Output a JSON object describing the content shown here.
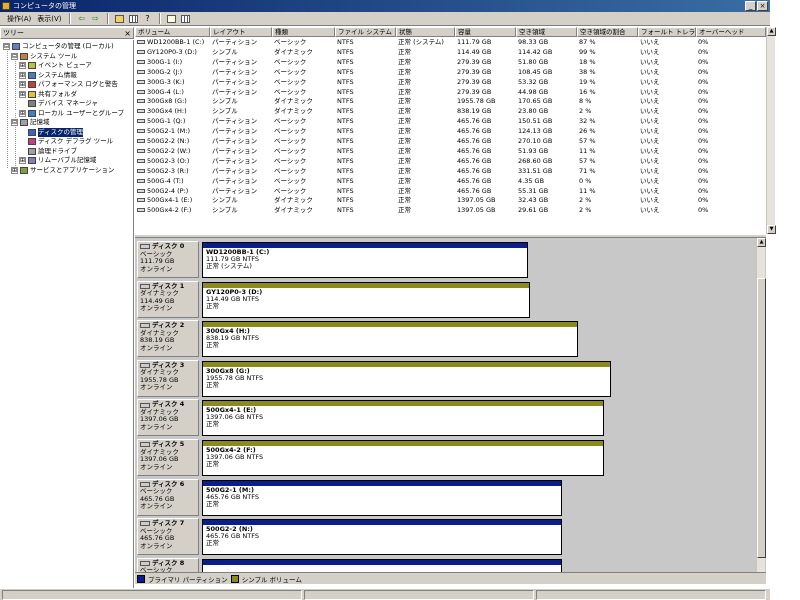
{
  "window": {
    "title": "コンピュータの管理",
    "minimize": "_",
    "close": "×"
  },
  "menu": {
    "items": [
      "操作(A)",
      "表示(V)"
    ]
  },
  "toolbar": {
    "back": "⇦",
    "forward": "⇨",
    "help": "?"
  },
  "tree": {
    "header": "ツリー",
    "close": "×",
    "nodes": [
      {
        "label": "コンピュータの管理 (ローカル)",
        "level": 0,
        "expander": "⊟",
        "icon": "computer-management-icon"
      },
      {
        "label": "システム ツール",
        "level": 1,
        "expander": "⊟",
        "icon": "tools-icon"
      },
      {
        "label": "イベント ビューア",
        "level": 2,
        "expander": "⊞",
        "icon": "event-viewer-icon"
      },
      {
        "label": "システム情報",
        "level": 2,
        "expander": "⊞",
        "icon": "system-info-icon"
      },
      {
        "label": "パフォーマンス ログと警告",
        "level": 2,
        "expander": "⊞",
        "icon": "performance-icon"
      },
      {
        "label": "共有フォルダ",
        "level": 2,
        "expander": "⊞",
        "icon": "shared-folder-icon"
      },
      {
        "label": "デバイス マネージャ",
        "level": 2,
        "expander": "",
        "icon": "device-manager-icon"
      },
      {
        "label": "ローカル ユーザーとグループ",
        "level": 2,
        "expander": "⊞",
        "icon": "users-icon"
      },
      {
        "label": "記憶域",
        "level": 1,
        "expander": "⊟",
        "icon": "storage-icon"
      },
      {
        "label": "ディスクの管理",
        "level": 2,
        "expander": "",
        "icon": "disk-management-icon",
        "selected": true
      },
      {
        "label": "ディスク デフラグ ツール",
        "level": 2,
        "expander": "",
        "icon": "defrag-icon"
      },
      {
        "label": "論理ドライブ",
        "level": 2,
        "expander": "",
        "icon": "logical-drive-icon"
      },
      {
        "label": "リムーバブル記憶域",
        "level": 2,
        "expander": "⊞",
        "icon": "removable-storage-icon"
      },
      {
        "label": "サービスとアプリケーション",
        "level": 1,
        "expander": "⊞",
        "icon": "services-icon"
      }
    ]
  },
  "volumes": {
    "columns": [
      "ボリューム",
      "レイアウト",
      "種類",
      "ファイル システム",
      "状態",
      "容量",
      "空き領域",
      "空き領域の割合",
      "フォールト トレラン...",
      "オーバーヘッド"
    ],
    "rows": [
      [
        "WD1200BB-1 (C:)",
        "パーティション",
        "ベーシック",
        "NTFS",
        "正常 (システム)",
        "111.79 GB",
        "98.33 GB",
        "87 %",
        "いいえ",
        "0%"
      ],
      [
        "GY120P0-3 (D:)",
        "シンプル",
        "ダイナミック",
        "NTFS",
        "正常",
        "114.49 GB",
        "114.42 GB",
        "99 %",
        "いいえ",
        "0%"
      ],
      [
        "300G-1 (I:)",
        "パーティション",
        "ベーシック",
        "NTFS",
        "正常",
        "279.39 GB",
        "51.80 GB",
        "18 %",
        "いいえ",
        "0%"
      ],
      [
        "300G-2 (J:)",
        "パーティション",
        "ベーシック",
        "NTFS",
        "正常",
        "279.39 GB",
        "108.45 GB",
        "38 %",
        "いいえ",
        "0%"
      ],
      [
        "300G-3 (K:)",
        "パーティション",
        "ベーシック",
        "NTFS",
        "正常",
        "279.39 GB",
        "53.32 GB",
        "19 %",
        "いいえ",
        "0%"
      ],
      [
        "300G-4 (L:)",
        "パーティション",
        "ベーシック",
        "NTFS",
        "正常",
        "279.39 GB",
        "44.98 GB",
        "16 %",
        "いいえ",
        "0%"
      ],
      [
        "300Gx8 (G:)",
        "シンプル",
        "ダイナミック",
        "NTFS",
        "正常",
        "1955.78 GB",
        "170.65 GB",
        "8 %",
        "いいえ",
        "0%"
      ],
      [
        "300Gx4 (H:)",
        "シンプル",
        "ダイナミック",
        "NTFS",
        "正常",
        "838.19 GB",
        "23.80 GB",
        "2 %",
        "いいえ",
        "0%"
      ],
      [
        "500G-1 (Q:)",
        "パーティション",
        "ベーシック",
        "NTFS",
        "正常",
        "465.76 GB",
        "150.51 GB",
        "32 %",
        "いいえ",
        "0%"
      ],
      [
        "500G2-1 (M:)",
        "パーティション",
        "ベーシック",
        "NTFS",
        "正常",
        "465.76 GB",
        "124.13 GB",
        "26 %",
        "いいえ",
        "0%"
      ],
      [
        "500G2-2 (N:)",
        "パーティション",
        "ベーシック",
        "NTFS",
        "正常",
        "465.76 GB",
        "270.10 GB",
        "57 %",
        "いいえ",
        "0%"
      ],
      [
        "500G2-2 (W:)",
        "パーティション",
        "ベーシック",
        "NTFS",
        "正常",
        "465.76 GB",
        "51.93 GB",
        "11 %",
        "いいえ",
        "0%"
      ],
      [
        "500G2-3 (O:)",
        "パーティション",
        "ベーシック",
        "NTFS",
        "正常",
        "465.76 GB",
        "268.60 GB",
        "57 %",
        "いいえ",
        "0%"
      ],
      [
        "500G2-3 (R:)",
        "パーティション",
        "ベーシック",
        "NTFS",
        "正常",
        "465.76 GB",
        "331.51 GB",
        "71 %",
        "いいえ",
        "0%"
      ],
      [
        "500G-4 (T:)",
        "パーティション",
        "ベーシック",
        "NTFS",
        "正常",
        "465.76 GB",
        "4.35 GB",
        "0 %",
        "いいえ",
        "0%"
      ],
      [
        "500G2-4 (P:)",
        "パーティション",
        "ベーシック",
        "NTFS",
        "正常",
        "465.76 GB",
        "55.31 GB",
        "11 %",
        "いいえ",
        "0%"
      ],
      [
        "500Gx4-1 (E:)",
        "シンプル",
        "ダイナミック",
        "NTFS",
        "正常",
        "1397.05 GB",
        "32.43 GB",
        "2 %",
        "いいえ",
        "0%"
      ],
      [
        "500Gx4-2 (F:)",
        "シンプル",
        "ダイナミック",
        "NTFS",
        "正常",
        "1397.05 GB",
        "29.61 GB",
        "2 %",
        "いいえ",
        "0%"
      ]
    ]
  },
  "disks": [
    {
      "name": "ディスク 0",
      "type": "ベーシック",
      "size": "111.79 GB",
      "status": "オンライン",
      "vol_name": "WD1200BB-1 (C:)",
      "vol_size": "111.79 GB NTFS",
      "vol_status": "正常 (システム)",
      "kind": "primary",
      "bar_fraction": 0.593
    },
    {
      "name": "ディスク 1",
      "type": "ダイナミック",
      "size": "114.49 GB",
      "status": "オンライン",
      "vol_name": "GY120P0-3 (D:)",
      "vol_size": "114.49 GB NTFS",
      "vol_status": "正常",
      "kind": "simple",
      "bar_fraction": 0.596
    },
    {
      "name": "ディスク 2",
      "type": "ダイナミック",
      "size": "838.19 GB",
      "status": "オンライン",
      "vol_name": "300Gx4 (H:)",
      "vol_size": "838.19 GB NTFS",
      "vol_status": "正常",
      "kind": "simple",
      "bar_fraction": 0.684
    },
    {
      "name": "ディスク 3",
      "type": "ダイナミック",
      "size": "1955.78 GB",
      "status": "オンライン",
      "vol_name": "300Gx8 (G:)",
      "vol_size": "1955.78 GB NTFS",
      "vol_status": "正常",
      "kind": "simple",
      "bar_fraction": 0.743
    },
    {
      "name": "ディスク 4",
      "type": "ダイナミック",
      "size": "1397.06 GB",
      "status": "オンライン",
      "vol_name": "500Gx4-1 (E:)",
      "vol_size": "1397.06 GB NTFS",
      "vol_status": "正常",
      "kind": "simple",
      "bar_fraction": 0.73
    },
    {
      "name": "ディスク 5",
      "type": "ダイナミック",
      "size": "1397.06 GB",
      "status": "オンライン",
      "vol_name": "500Gx4-2 (F:)",
      "vol_size": "1397.06 GB NTFS",
      "vol_status": "正常",
      "kind": "simple",
      "bar_fraction": 0.73
    },
    {
      "name": "ディスク 6",
      "type": "ベーシック",
      "size": "465.76 GB",
      "status": "オンライン",
      "vol_name": "500G2-1 (M:)",
      "vol_size": "465.76 GB NTFS",
      "vol_status": "正常",
      "kind": "primary",
      "bar_fraction": 0.654
    },
    {
      "name": "ディスク 7",
      "type": "ベーシック",
      "size": "465.76 GB",
      "status": "オンライン",
      "vol_name": "500G2-2 (N:)",
      "vol_size": "465.76 GB NTFS",
      "vol_status": "正常",
      "kind": "primary",
      "bar_fraction": 0.654
    },
    {
      "name": "ディスク 8",
      "type": "ベーシック",
      "size": "",
      "status": "",
      "vol_name": "",
      "vol_size": "",
      "vol_status": "",
      "kind": "primary",
      "bar_fraction": 0.654
    }
  ],
  "legend": {
    "primary": "プライマリ パーティション",
    "simple": "シンプル ボリューム"
  },
  "colors": {
    "primary": "#0a1e8c",
    "simple": "#8a8a1e",
    "title_bar": "#0a246a",
    "selection": "#0a246a"
  }
}
